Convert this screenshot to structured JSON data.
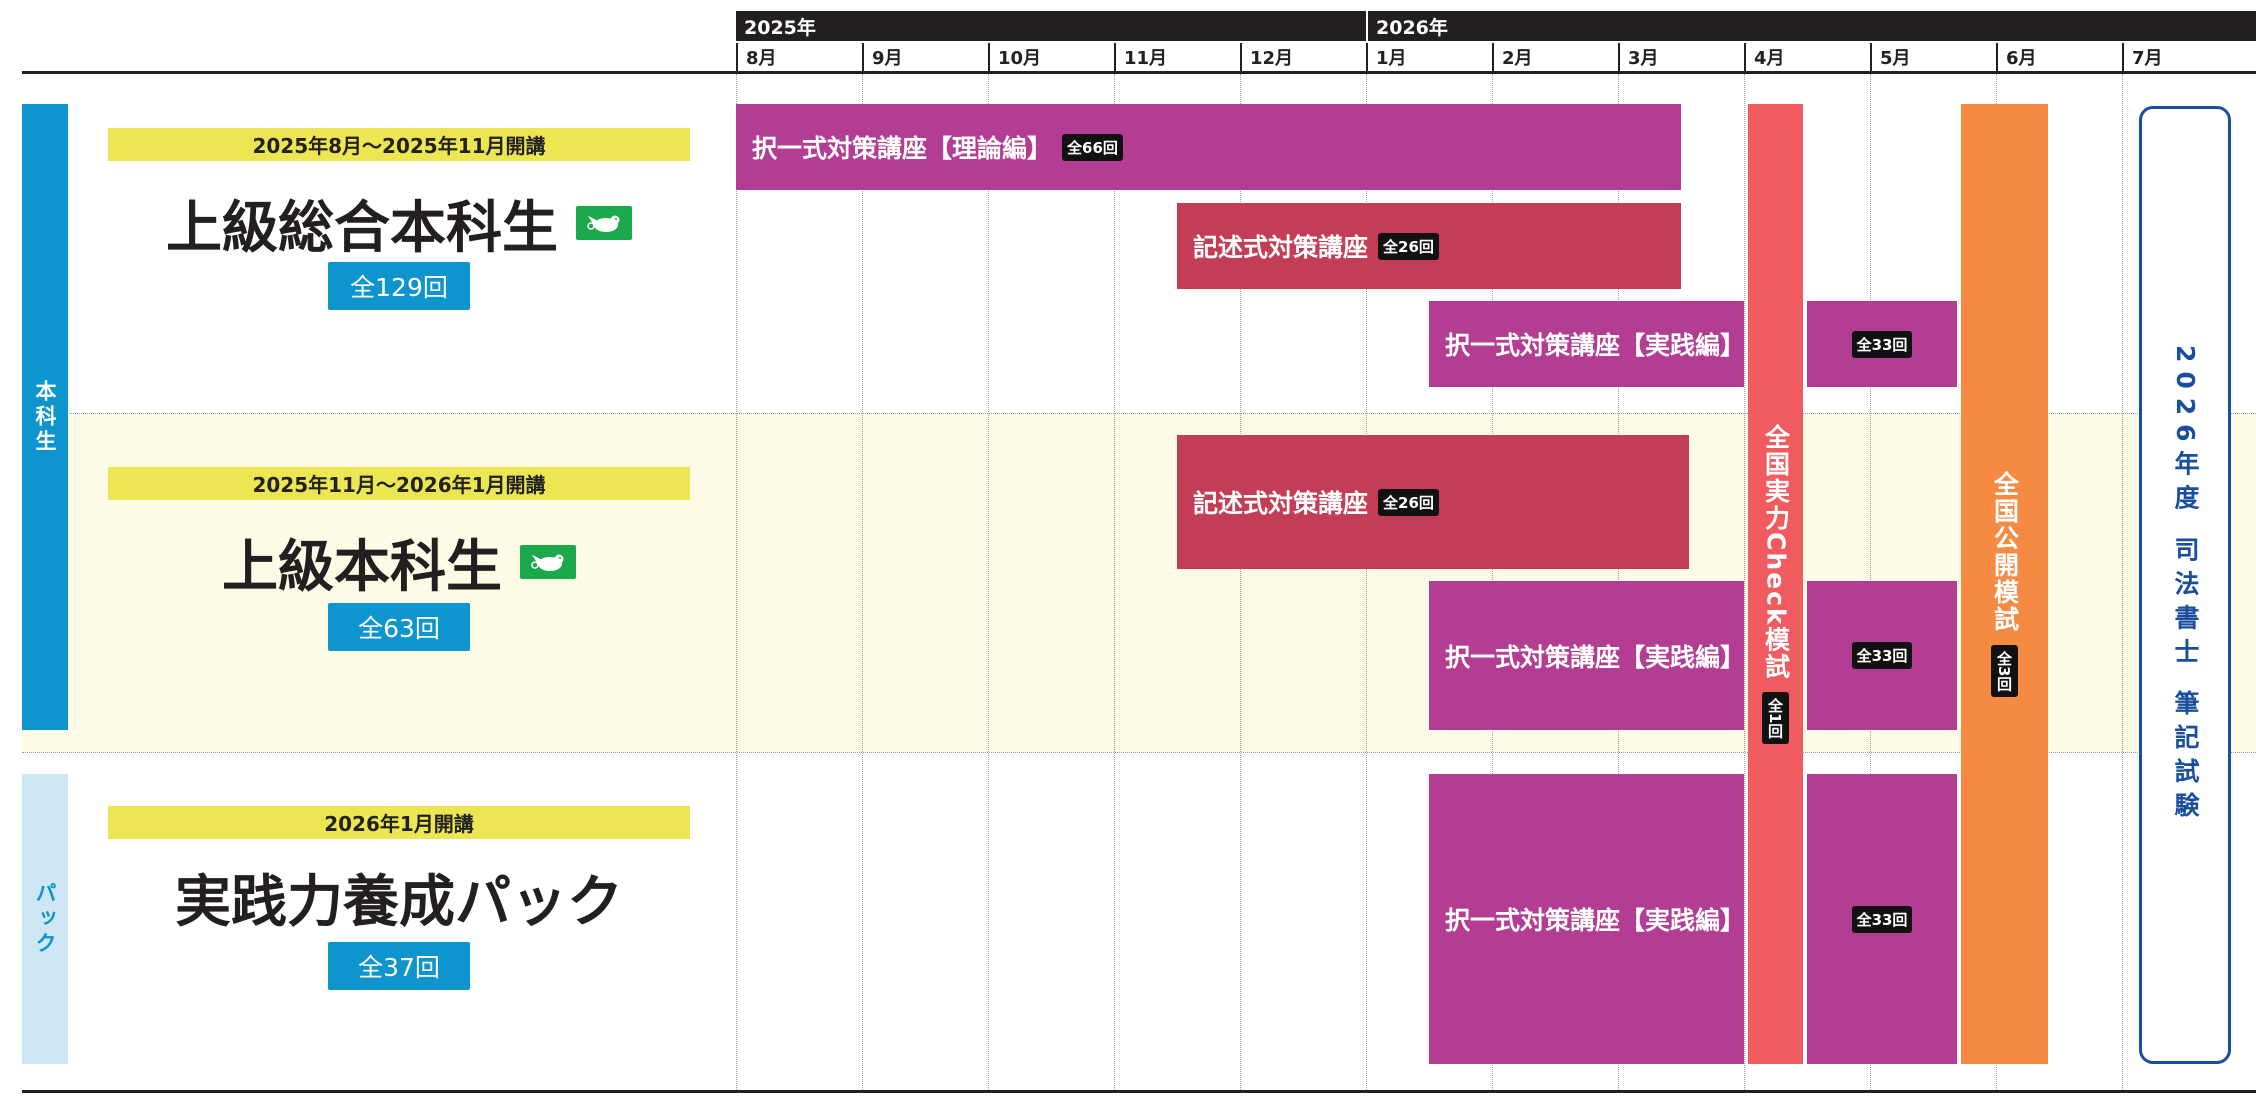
{
  "header": {
    "years": [
      "2025年",
      "2026年"
    ],
    "months": [
      "8月",
      "9月",
      "10月",
      "11月",
      "12月",
      "1月",
      "2月",
      "3月",
      "4月",
      "5月",
      "6月",
      "7月"
    ]
  },
  "side_tabs": {
    "main": "本科生",
    "pack": "パック"
  },
  "courses": [
    {
      "period": "2025年8月～2025年11月開講",
      "title": "上級総合本科生",
      "count": "全129回"
    },
    {
      "period": "2025年11月～2026年1月開講",
      "title": "上級本科生",
      "count": "全63回"
    },
    {
      "period": "2026年1月開講",
      "title": "実践力養成パック",
      "count": "全37回"
    }
  ],
  "bars": {
    "theory": {
      "label": "択一式対策講座【理論編】",
      "count": "全66回"
    },
    "written": {
      "label": "記述式対策講座",
      "count": "全26回"
    },
    "practice": {
      "label": "択一式対策講座【実践編】",
      "count": "全33回"
    }
  },
  "national_check": {
    "label": "全国実力Check模試",
    "count": "全1回"
  },
  "national_open": {
    "label": "全国公開模試",
    "count": "全3回"
  },
  "exam": {
    "label": "2026年度 司法書士 筆記試験"
  },
  "colors": {
    "purple": "#b23d92",
    "crimson": "#c33d57",
    "check": "#ef5b5e",
    "open": "#f58b43",
    "blue": "#0e95cd",
    "exam": "#1a4e9e",
    "yellow": "#ece653"
  }
}
